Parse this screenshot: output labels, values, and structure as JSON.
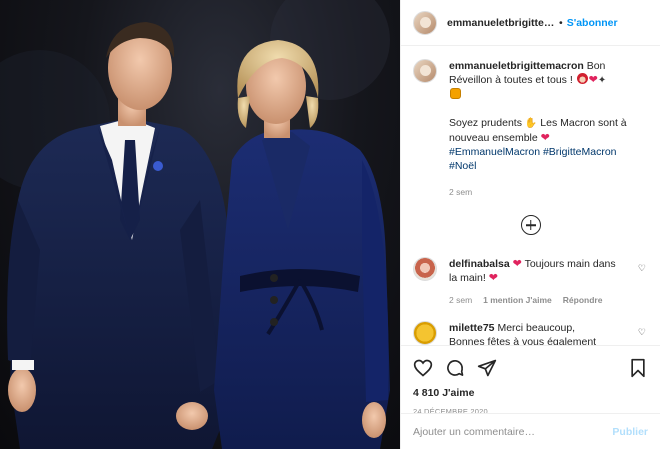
{
  "header": {
    "username": "emmanueletbrigittemacron",
    "separator": "•",
    "follow_label": "S'abonner",
    "avatar": "profile-avatar"
  },
  "caption": {
    "username": "emmanueletbrigittemacron",
    "line1": "Bon Réveillon à toutes et tous !",
    "line2": "Soyez prudents",
    "line3": "Les Macron sont à nouveau ensemble",
    "hashtags": [
      "#EmmanuelMacron",
      "#BrigitteMacron",
      "#Noël"
    ],
    "time": "2 sem",
    "emojis": [
      "santa-emoji",
      "heart-emoji",
      "tree-emoji",
      "gift-emoji",
      "pray-emoji",
      "heart-emoji"
    ]
  },
  "load_more_icon": "plus-circle-icon",
  "comments": [
    {
      "username": "delfinabalsa",
      "text_a": "Toujours main dans la main!",
      "time": "2 sem",
      "likes": "1 mention J'aime",
      "reply": "Répondre"
    },
    {
      "username": "milette75",
      "text_a": "Merci beaucoup,",
      "text_b": "Bonnes fêtes à vous également"
    }
  ],
  "actions": {
    "icons": [
      "heart-icon",
      "comment-icon",
      "share-icon",
      "bookmark-icon"
    ],
    "likes": "4 810 J'aime",
    "date": "24 décembre 2020"
  },
  "add_comment": {
    "placeholder": "Ajouter un commentaire…",
    "post_label": "Publier"
  },
  "colors": {
    "link": "#0095f6",
    "hashtag": "#00376b",
    "muted": "#8e8e8e",
    "post_disabled": "#b2dffc"
  }
}
